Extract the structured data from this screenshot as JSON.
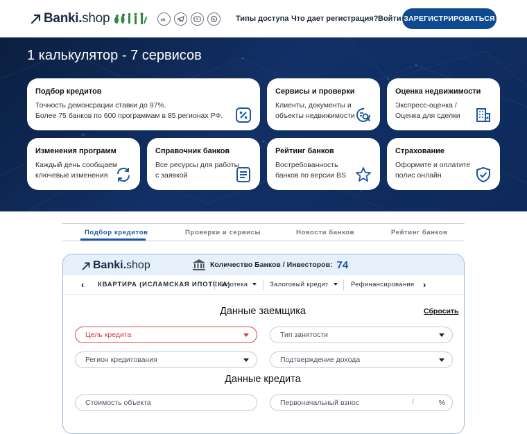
{
  "header": {
    "brand_bold": "Banki.",
    "brand_light": "shop",
    "nav": [
      "Типы доступа",
      "Что дает регистрация?",
      "Войти"
    ],
    "cta": "ЗАРЕГИСТРИРОВАТЬСЯ",
    "socials": [
      "vk-icon",
      "telegram-icon",
      "youtube-icon",
      "whatsapp-icon"
    ]
  },
  "hero": {
    "title": "1 калькулятор - 7 сервисов",
    "cards": [
      {
        "title": "Подбор кредитов",
        "text": [
          "Точность демонсрации ставки до 97%.",
          "Более 75 банков по 600 программам в 85 регионах РФ."
        ],
        "icon": "percent-icon"
      },
      {
        "title": "Сервисы и проверки",
        "text": [
          "Клиенты, документы и",
          "объекты недвижимости"
        ],
        "icon": "search-doc-icon"
      },
      {
        "title": "Оценка недвижимости",
        "text": [
          "Экспресс-оценка /",
          "Оценка для сделки"
        ],
        "icon": "building-icon"
      },
      {
        "title": "Изменения программ",
        "text": [
          "Каждый день сообщаем",
          "ключевые изменения"
        ],
        "icon": "refresh-icon"
      },
      {
        "title": "Справочник банков",
        "text": [
          "Все ресурсы для работы",
          "с заявкой"
        ],
        "icon": "document-icon"
      },
      {
        "title": "Рейтинг банков",
        "text": [
          "Востребованность",
          "банков по версии BS"
        ],
        "icon": "star-icon"
      },
      {
        "title": "Страхование",
        "text": [
          "Оформите и оплатите",
          "полис онлайн"
        ],
        "icon": "shield-icon"
      }
    ]
  },
  "tabs": [
    "Подбор кредитов",
    "Проверки и сервисы",
    "Новости банков",
    "Рейтинг банков"
  ],
  "widget": {
    "brand_bold": "Banki.",
    "brand_light": "shop",
    "count_label": "Количество Банков / Инвесторов:",
    "count_value": "74",
    "filters": [
      "КВАРТИРА (ИСЛАМСКАЯ ИПОТЕКА)",
      "Ипотека",
      "Залоговый кредит",
      "Рефинансирование"
    ],
    "borrower_title": "Данные заемщика",
    "reset": "Сбросить",
    "fields_borrower": [
      "Цель кредита",
      "Тип занятости",
      "Регион кредитования",
      "Подтверждение дохода"
    ],
    "credit_title": "Данные кредита",
    "fields_credit": [
      "Стоимость объекта",
      "Первоначальный взнос"
    ],
    "unit_slash": "/",
    "unit_percent": "%"
  },
  "colors": {
    "accent": "#0d4a8f",
    "tab_active": "#1e56a0",
    "error": "#e14545",
    "hero_bg": "#0f2a58"
  }
}
